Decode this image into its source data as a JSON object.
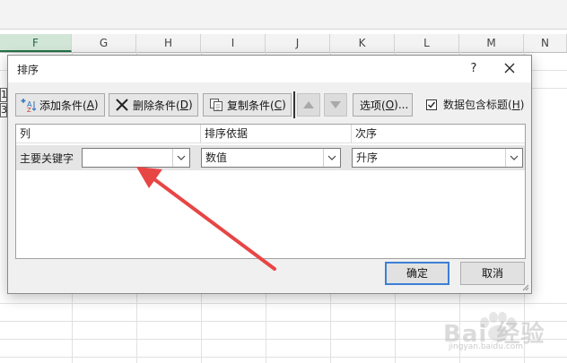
{
  "spreadsheet": {
    "columns": [
      "F",
      "G",
      "H",
      "I",
      "J",
      "K",
      "L",
      "M",
      "N"
    ],
    "selected_column": "F",
    "left_row_marks": [
      "1",
      "3"
    ]
  },
  "dialog": {
    "title": "排序",
    "help_label": "?",
    "close_label": "✕",
    "toolbar": {
      "add_label": "添加条件(",
      "add_key": "A",
      "delete_label": "删除条件(",
      "delete_key": "D",
      "copy_label": "复制条件(",
      "copy_key": "C",
      "options_label": "选项(",
      "options_key": "O",
      "options_suffix": ")...",
      "paren_close": ")"
    },
    "header_checkbox": {
      "label": "数据包含标题(",
      "key": "H",
      "suffix": ")",
      "checked": true
    },
    "table_headers": [
      "列",
      "排序依据",
      "次序"
    ],
    "row": {
      "label": "主要关键字",
      "column_value": "",
      "sort_on": "数值",
      "order": "升序"
    },
    "ok_label": "确定",
    "cancel_label": "取消"
  },
  "annotation": {
    "arrow_color": "#e84545"
  },
  "watermark": {
    "text": "Bai 经验",
    "sub": "jingyan.baidu.com"
  }
}
